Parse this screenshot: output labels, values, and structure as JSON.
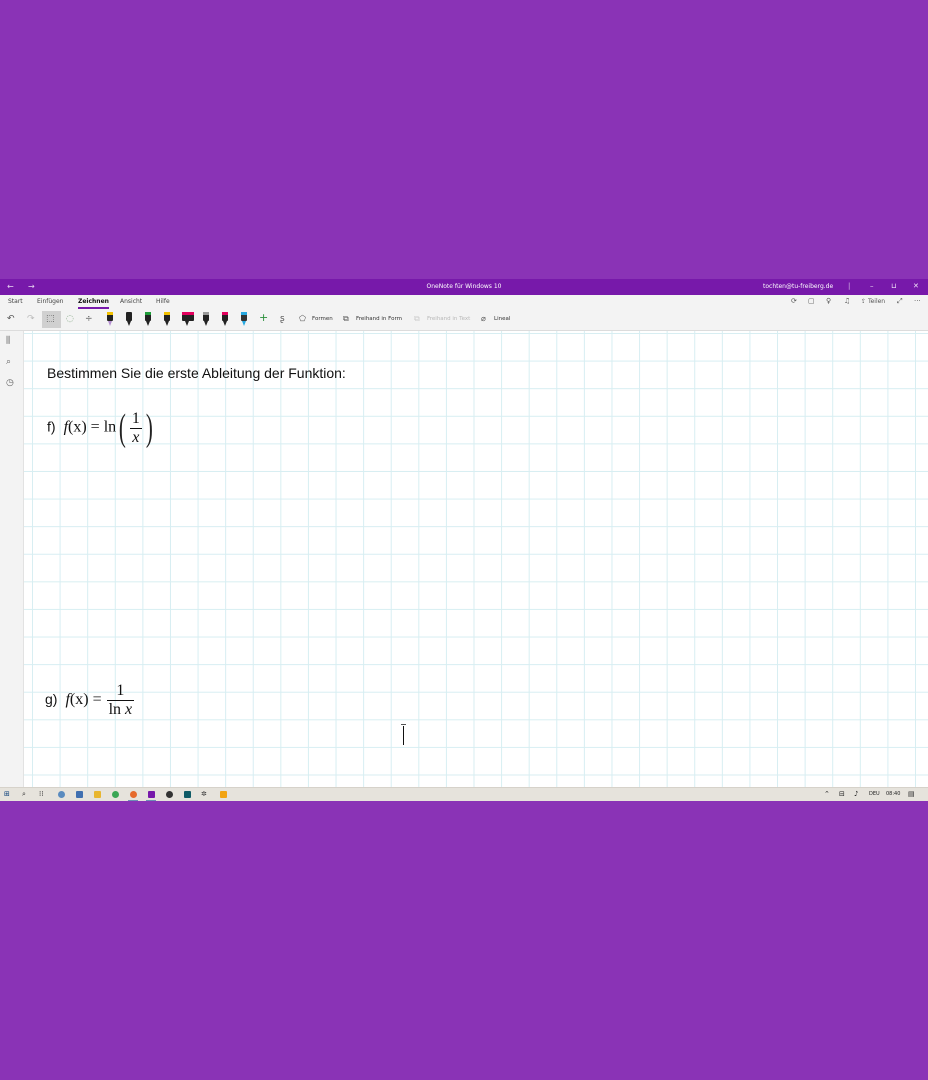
{
  "window": {
    "title": "OneNote für Windows 10",
    "account": "tochten@tu-freiberg.de",
    "back_icon": "arrow-left-icon",
    "forward_icon": "arrow-right-icon",
    "minimize": "–",
    "restore": "⊔",
    "close": "✕"
  },
  "tabs": [
    "Start",
    "Einfügen",
    "Zeichnen",
    "Ansicht",
    "Hilfe"
  ],
  "active_tab": "Zeichnen",
  "ribbon_right": {
    "share_label": "Teilen",
    "more": "···"
  },
  "toolbar": {
    "shapes_label": "Formen",
    "ink_to_shape_label": "Freihand in Form",
    "ink_to_text_label": "Freihand in Text",
    "ruler_label": "Lineal",
    "pen_colors": [
      "#222222",
      "#2b2b2b",
      "#1f9d3a",
      "#f2c100",
      "#e3005d",
      "#555555",
      "#e3005d",
      "#27a9e1"
    ]
  },
  "page": {
    "instruction": "Bestimmen Sie die erste Ableitung der Funktion:",
    "problem_f": {
      "label": "f)",
      "lhs_func": "f",
      "lhs_arg": "(x)",
      "eq": "=",
      "op": "ln",
      "num": "1",
      "den": "x"
    },
    "problem_g": {
      "label": "g)",
      "lhs_func": "f",
      "lhs_arg": "(x)",
      "eq": "=",
      "num": "1",
      "den_op": "ln",
      "den_var": "x"
    }
  },
  "taskbar": {
    "language": "DEU",
    "time": "08:40"
  },
  "colors": {
    "background": "#8a33b6",
    "titlebar": "#7719aa",
    "grid": "#d7eef2"
  }
}
